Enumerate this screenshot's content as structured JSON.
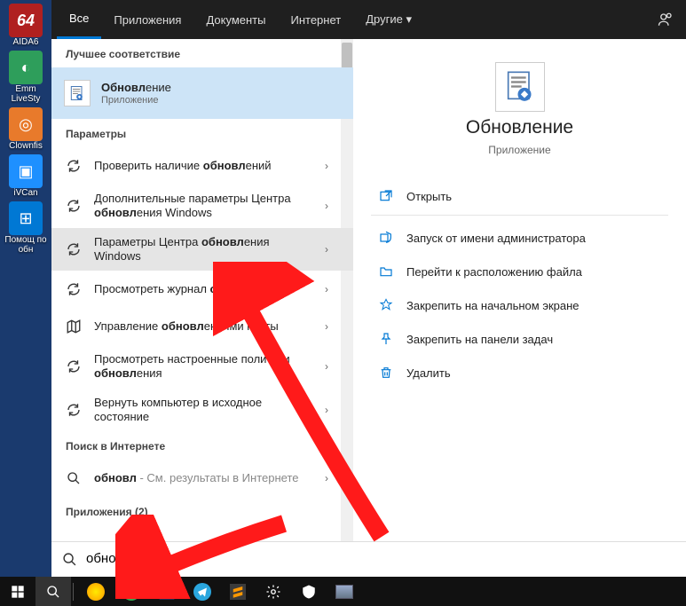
{
  "desktop": {
    "items": [
      {
        "label": "AIDA6",
        "bg": "#b02020",
        "glyph": "64"
      },
      {
        "label": "Emm LiveSty",
        "bg": "#2e9e5b",
        "glyph": "◐"
      },
      {
        "label": "Clownfis",
        "bg": "#e87a2b",
        "glyph": "◎"
      },
      {
        "label": "iVCan",
        "bg": "#1e90ff",
        "glyph": "▣"
      },
      {
        "label": "Помощ по обн",
        "bg": "#0078d4",
        "glyph": "⊞"
      }
    ]
  },
  "tabs": {
    "items": [
      "Все",
      "Приложения",
      "Документы",
      "Интернет",
      "Другие ▾"
    ],
    "active_index": 0
  },
  "left": {
    "best_header": "Лучшее соответствие",
    "best_match": {
      "title_html": "<b>Обновл</b>ение",
      "sub": "Приложение"
    },
    "settings_header": "Параметры",
    "settings": [
      {
        "icon": "sync",
        "title_html": "Проверить наличие <b>обновл</b>ений",
        "hover": false
      },
      {
        "icon": "sync",
        "title_html": "Дополнительные параметры Центра <b>обновл</b>ения Windows",
        "hover": false
      },
      {
        "icon": "sync",
        "title_html": "Параметры Центра <b>обновл</b>ения Windows",
        "hover": true
      },
      {
        "icon": "sync",
        "title_html": "Просмотреть журнал <b>обновл</b>ений",
        "hover": false
      },
      {
        "icon": "map",
        "title_html": "Управление <b>обновл</b>ениями карты",
        "hover": false
      },
      {
        "icon": "sync",
        "title_html": "Просмотреть настроенные политики <b>обновл</b>ения",
        "hover": false
      },
      {
        "icon": "sync",
        "title_html": "Вернуть компьютер в исходное состояние",
        "hover": false
      }
    ],
    "web_header": "Поиск в Интернете",
    "web": {
      "title_html": "<b>обновл</b> <span class='gray-after'>- См. результаты в Интернете</span>"
    },
    "apps_header": "Приложения (2)"
  },
  "preview": {
    "title": "Обновление",
    "sub": "Приложение",
    "actions": [
      {
        "icon": "open",
        "label": "Открыть"
      },
      {
        "sep": true
      },
      {
        "icon": "admin",
        "label": "Запуск от имени администратора"
      },
      {
        "icon": "folder",
        "label": "Перейти к расположению файла"
      },
      {
        "icon": "pin-start",
        "label": "Закрепить на начальном экране"
      },
      {
        "icon": "pin-task",
        "label": "Закрепить на панели задач"
      },
      {
        "icon": "trash",
        "label": "Удалить"
      }
    ]
  },
  "searchbox": {
    "typed": "обновл",
    "ghost": "ение"
  },
  "taskbar": {
    "items": [
      "start",
      "search",
      "yandex",
      "chrome",
      "save",
      "telegram",
      "sublime",
      "gear",
      "shield",
      "task"
    ]
  }
}
